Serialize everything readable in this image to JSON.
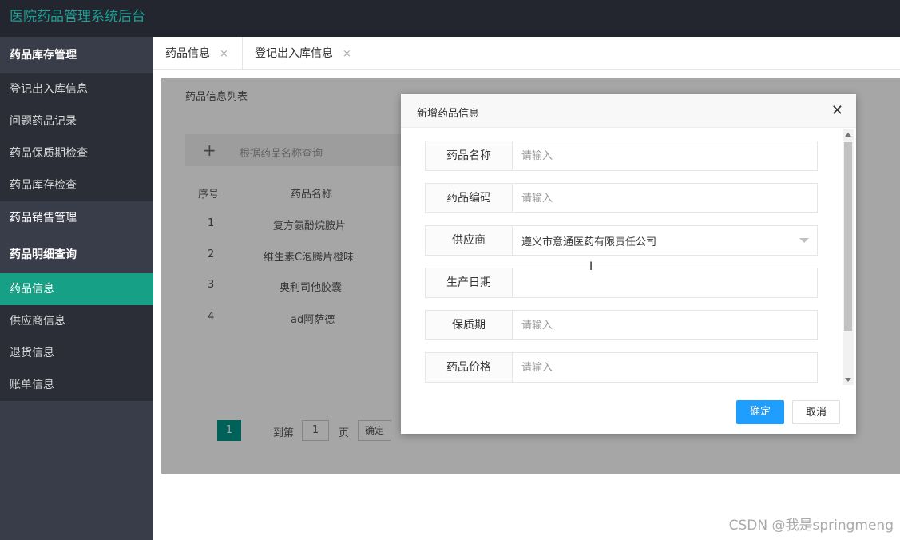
{
  "app": {
    "title": "医院药品管理系统后台"
  },
  "sidebar": {
    "group1": "药品库存管理",
    "items1": [
      "登记出入库信息",
      "问题药品记录",
      "药品保质期检查",
      "药品库存检查"
    ],
    "group2": "药品销售管理",
    "group3": "药品明细查询",
    "items3": [
      "药品信息",
      "供应商信息",
      "退货信息",
      "账单信息"
    ]
  },
  "tabs": [
    {
      "label": "药品信息",
      "close": "×"
    },
    {
      "label": "登记出入库信息",
      "close": "×"
    }
  ],
  "background": {
    "list_title": "药品信息列表",
    "add_icon": "+",
    "search_placeholder": "根据药品名称查询",
    "columns": [
      "序号",
      "药品名称"
    ],
    "rows": [
      {
        "no": "1",
        "name": "复方氨酚烷胺片"
      },
      {
        "no": "2",
        "name": "维生素C泡腾片橙味"
      },
      {
        "no": "3",
        "name": "奥利司他胶囊"
      },
      {
        "no": "4",
        "name": "ad阿萨德"
      }
    ],
    "pagination": {
      "current": "1",
      "goto_label": "到第",
      "page_value": "1",
      "page_label": "页",
      "confirm": "确定"
    }
  },
  "modal": {
    "title": "新增药品信息",
    "close": "✕",
    "fields": [
      {
        "label": "药品名称",
        "placeholder": "请输入",
        "value": ""
      },
      {
        "label": "药品编码",
        "placeholder": "请输入",
        "value": ""
      },
      {
        "label": "供应商",
        "placeholder": "",
        "value": "遵义市意通医药有限责任公司"
      },
      {
        "label": "生产日期",
        "placeholder": "",
        "value": ""
      },
      {
        "label": "保质期",
        "placeholder": "请输入",
        "value": ""
      },
      {
        "label": "药品价格",
        "placeholder": "请输入",
        "value": ""
      }
    ],
    "ok": "确定",
    "cancel": "取消"
  },
  "watermark": "CSDN @我是springmeng"
}
